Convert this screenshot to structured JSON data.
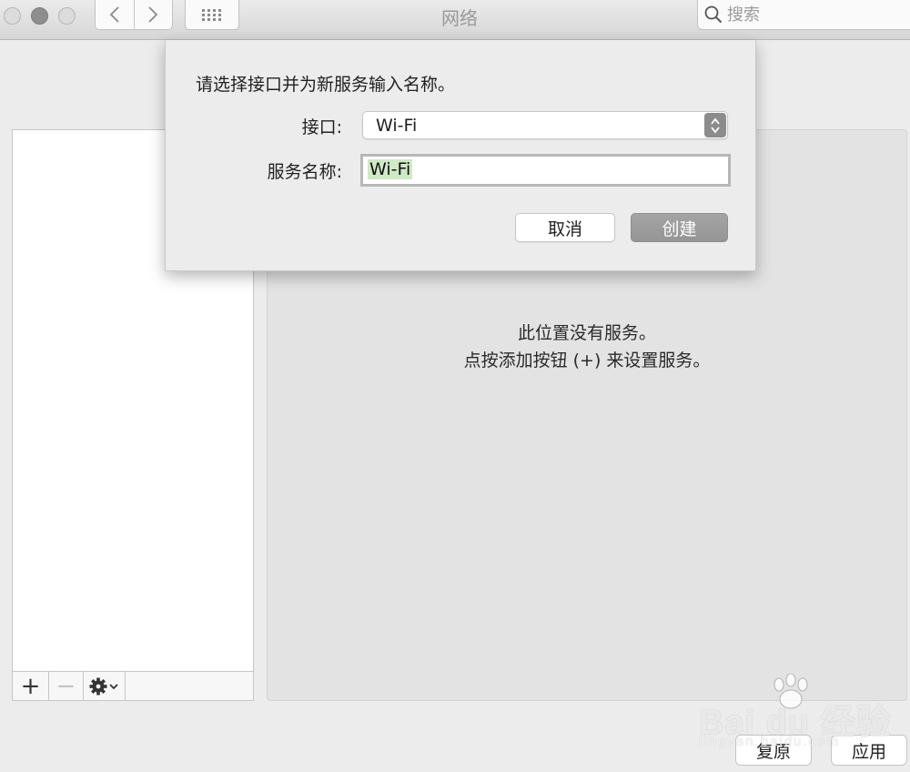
{
  "window": {
    "title": "网络"
  },
  "toolbar": {
    "back_icon": "chevron-left-icon",
    "forward_icon": "chevron-right-icon",
    "grid_icon": "grid-icon",
    "search_placeholder": "搜索"
  },
  "sidebar": {
    "add_label": "+",
    "remove_label": "−",
    "gear_icon": "gear-icon"
  },
  "detail": {
    "empty_line1": "此位置没有服务。",
    "empty_line2": "点按添加按钮 (+) 来设置服务。"
  },
  "footer": {
    "revert_label": "复原",
    "apply_label": "应用"
  },
  "sheet": {
    "title": "请选择接口并为新服务输入名称。",
    "interface_label": "接口:",
    "interface_value": "Wi-Fi",
    "service_name_label": "服务名称:",
    "service_name_value": "Wi-Fi",
    "cancel_label": "取消",
    "create_label": "创建"
  },
  "watermark": {
    "logo": "Bai  du 经验",
    "url": "jingyan.baidu.com"
  },
  "colors": {
    "selection_highlight": "#cfe9c6",
    "default_button": "#999999"
  }
}
